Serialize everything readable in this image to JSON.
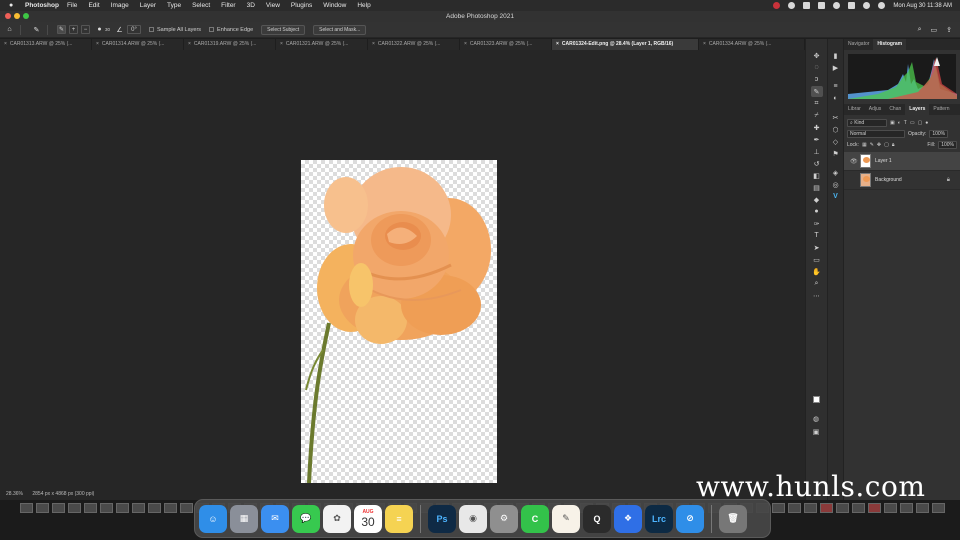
{
  "menubar": {
    "app_name": "Photoshop",
    "menus": [
      "File",
      "Edit",
      "Image",
      "Layer",
      "Type",
      "Select",
      "Filter",
      "3D",
      "View",
      "Plugins",
      "Window",
      "Help"
    ],
    "datetime": "Mon Aug 30  11:38 AM"
  },
  "window": {
    "title": "Adobe Photoshop 2021"
  },
  "options": {
    "brush_size": "30",
    "sample_all_layers": "Sample All Layers",
    "enhance_edge": "Enhance Edge",
    "select_subject": "Select Subject",
    "select_and_mask": "Select and Mask..."
  },
  "tabs": [
    {
      "label": "CAR01313.ARW @ 25% (...",
      "active": false
    },
    {
      "label": "CAR01314.ARW @ 25% (...",
      "active": false
    },
    {
      "label": "CAR01319.ARW @ 25% (...",
      "active": false
    },
    {
      "label": "CAR01321.ARW @ 25% (...",
      "active": false
    },
    {
      "label": "CAR01322.ARW @ 25% (...",
      "active": false
    },
    {
      "label": "CAR01323.ARW @ 25% (...",
      "active": false
    },
    {
      "label": "CAR01324-Edit.png @ 28.4% (Layer 1, RGB/16)",
      "active": true
    },
    {
      "label": "CAR01334.ARW @ 25% (...",
      "active": false
    }
  ],
  "status": {
    "zoom": "28.36%",
    "doc_size": "2854 px x 4868 px (300 ppi)"
  },
  "panels": {
    "top_tabs": [
      "Navigator",
      "Histogram"
    ],
    "layer_tabs": [
      "Librar",
      "Adjus",
      "Chan",
      "Layers",
      "Pattern"
    ],
    "kind_filter": "Kind",
    "blend_mode": "Normal",
    "opacity_label": "Opacity:",
    "opacity_value": "100%",
    "lock_label": "Lock:",
    "fill_label": "Fill:",
    "fill_value": "100%",
    "layers": [
      {
        "name": "Layer 1",
        "visible": true,
        "selected": true
      },
      {
        "name": "Background",
        "visible": false,
        "selected": false
      }
    ]
  },
  "dock": {
    "apps": [
      {
        "icon": "finder-icon",
        "color": "#2f8ee8",
        "glyph": "☺"
      },
      {
        "icon": "launchpad-icon",
        "color": "#8a8f99",
        "glyph": "▦"
      },
      {
        "icon": "mail-icon",
        "color": "#3b8ff0",
        "glyph": "✉"
      },
      {
        "icon": "messages-icon",
        "color": "#37c94f",
        "glyph": "💬"
      },
      {
        "icon": "photos-icon",
        "color": "#f2f2f2",
        "glyph": "✿"
      },
      {
        "icon": "calendar-icon",
        "color": "#ffffff",
        "glyph": "30"
      },
      {
        "icon": "notes-icon",
        "color": "#f5d352",
        "glyph": "≡"
      },
      {
        "icon": "photoshop-icon",
        "color": "#0f2a45",
        "glyph": "Ps"
      },
      {
        "icon": "chrome-icon",
        "color": "#e8e8e8",
        "glyph": "◉"
      },
      {
        "icon": "system-preferences-icon",
        "color": "#8f8f8f",
        "glyph": "⚙"
      },
      {
        "icon": "camo-icon",
        "color": "#33c24a",
        "glyph": "C"
      },
      {
        "icon": "pages-icon",
        "color": "#f7f2e8",
        "glyph": "✎"
      },
      {
        "icon": "quicktime-icon",
        "color": "#2b2b2b",
        "glyph": "Q"
      },
      {
        "icon": "dropbox-icon",
        "color": "#2f6fe6",
        "glyph": "❖"
      },
      {
        "icon": "lightroom-classic-icon",
        "color": "#0d2a44",
        "glyph": "Lrc"
      },
      {
        "icon": "safari-icon",
        "color": "#2f8ee8",
        "glyph": "⊘"
      },
      {
        "icon": "trash-icon",
        "color": "#777777",
        "glyph": "🗑"
      }
    ]
  },
  "calendar_month": "AUG",
  "watermark": "www.hunls.com",
  "colors": {
    "foreground": "#ffffff",
    "background": "#e59f4c",
    "rose": "#f0a661"
  }
}
